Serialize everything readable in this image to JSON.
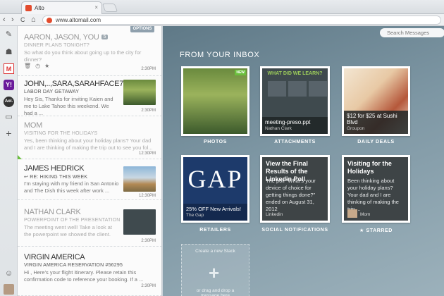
{
  "browser": {
    "tab_title": "Alto",
    "tab_close": "×",
    "url": "www.altomail.com",
    "back": "‹",
    "forward": "›",
    "reload": "C",
    "home": "⌂"
  },
  "rail": {
    "compose": "✎",
    "hat": "☗",
    "gmail": "M",
    "yahoo": "Y!",
    "aol": "Aol.",
    "folder": "▭",
    "add": "+",
    "contacts": "☺"
  },
  "message_list": {
    "options_label": "OPTIONS",
    "messages": [
      {
        "from": "AARON, JASON, YOU",
        "count": "5",
        "subject": "DINNER PLANS TONIGHT?",
        "preview": "So what do you think about going up to the city for dinner?",
        "time": "2:30PM",
        "read": true
      },
      {
        "from": "JOHN,..,SARA,SARAHFACE75",
        "count": "5",
        "subject": "LABOR DAY GETAWAY",
        "preview": "Hey Sis, Thanks for inviting Kaien and me to Lake Tahoe this weekend. We had a ...",
        "time": "2:30PM",
        "read": false
      },
      {
        "from": "MOM",
        "count": "",
        "subject": "VISITING FOR THE HOLIDAYS",
        "preview": "Yes, been thinking about your holiday plans? Your dad and I are thinking of making the trip out to see you fol...",
        "time": "12:30PM",
        "read": true
      },
      {
        "from": "JAMES HEDRICK",
        "count": "",
        "subject": "RE: HIKING THIS WEEK",
        "preview": "I'm staying with my friend in San Antonio and The Dish this week after work ...",
        "time": "12:30PM",
        "read": false
      },
      {
        "from": "NATHAN CLARK",
        "count": "",
        "subject": "POWERPOINT OF THE PRESENTATION",
        "preview": "The meeting went well! Take a look at the powerpoint we showed the client.",
        "time": "2:30PM",
        "read": true
      },
      {
        "from": "VIRGIN AMERICA",
        "count": "",
        "subject": "VIRGIN AMERICA RESERVATION #56295",
        "preview": "Hi , Here's your flight itinerary. Please retain this confirmation code to reference your booking. If a ...",
        "time": "2:30PM",
        "read": false
      }
    ]
  },
  "main": {
    "search_placeholder": "Search Messages",
    "section_title": "FROM YOUR INBOX",
    "new_badge": "NEW",
    "cards": {
      "photos_label": "PHOTOS",
      "attachments_label": "ATTACHMENTS",
      "attachments_filename": "meeting-preso.ppt",
      "attachments_from": "Nathan Clark",
      "attachments_slide_title": "WHAT DID WE LEARN?",
      "deals_label": "DAILY DEALS",
      "deals_caption": "$12 for $25 at Sushi Blvd",
      "deals_from": "Groupon",
      "retailers_label": "RETAILERS",
      "retailers_logo": "GAP",
      "retailers_caption": "25% OFF New Arrivals!",
      "retailers_from": "The Gap",
      "social_label": "SOCIAL NOTIFICATIONS",
      "social_title": "View the Final Results of the Linkedin Poll",
      "social_body": "The poll \"What's your device of choice for getting things done?\" ended on August 31, 2012",
      "social_from": "Linkedin",
      "starred_label": "★ STARRED",
      "starred_title": "Visiting for the Holidays",
      "starred_body": "Been thinking about your holiday plans? Your dad and I are thinking of making the trip ...",
      "starred_from": "Mom"
    },
    "stack_create": "Create a new Stack",
    "stack_drag": "or drag and drop a message here"
  }
}
